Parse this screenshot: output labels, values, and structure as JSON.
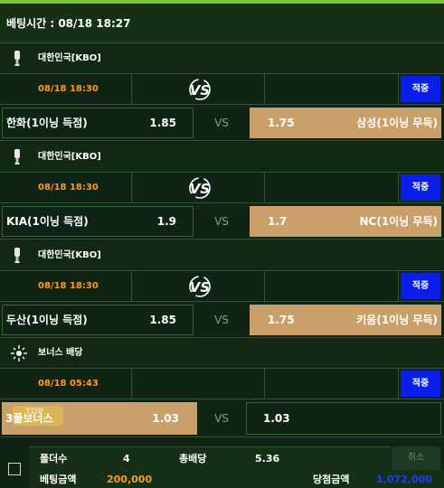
{
  "bet_time": "베팅시간 : 08/18 18:27",
  "games": [
    {
      "league": "대한민국[KBO]",
      "time": "08/18 18:30",
      "apply_label": "적중",
      "home_team": "한화(1이닝 득점)",
      "home_odds": "1.85",
      "vs_label": "VS",
      "away_odds": "1.75",
      "away_team": "삼성(1이닝 무득)"
    },
    {
      "league": "대한민국[KBO]",
      "time": "08/18 18:30",
      "apply_label": "적중",
      "home_team": "KIA(1이닝 득점)",
      "home_odds": "1.9",
      "vs_label": "VS",
      "away_odds": "1.7",
      "away_team": "NC(1이닝 무득)"
    },
    {
      "league": "대한민국[KBO]",
      "time": "08/18 18:30",
      "apply_label": "적중",
      "home_team": "두산(1이닝 득점)",
      "home_odds": "1.85",
      "vs_label": "VS",
      "away_odds": "1.75",
      "away_team": "키움(1이닝 무득)"
    }
  ],
  "bonus": {
    "league": "보너스 배당",
    "time": "08/18 05:43",
    "apply_label": "적중",
    "home_team": "3폴보너스",
    "home_odds": "1.03",
    "vs_label": "VS",
    "away_odds": "1.03",
    "badge": "TOP"
  },
  "footer": {
    "folder_label": "폴더수",
    "folder_count": "4",
    "total_odds_label": "총배당",
    "total_odds": "5.36",
    "cancel_label": "취소",
    "bet_amount_label": "베팅금액",
    "bet_amount": "200,000",
    "win_amount_label": "당첨금액",
    "win_amount": "1,072,000"
  },
  "colors": {
    "background": "#0f2414",
    "accent_line": "#7cc63a",
    "time_orange": "#ff9a1f",
    "apply_blue": "#0a1fe8",
    "selected_gold": "#c9a06a",
    "win_amount_blue": "#1a3cff"
  },
  "icons": {
    "league": "baseball-bat-icon",
    "bonus": "bonus-star-icon",
    "vs": "vs-logo-icon"
  }
}
